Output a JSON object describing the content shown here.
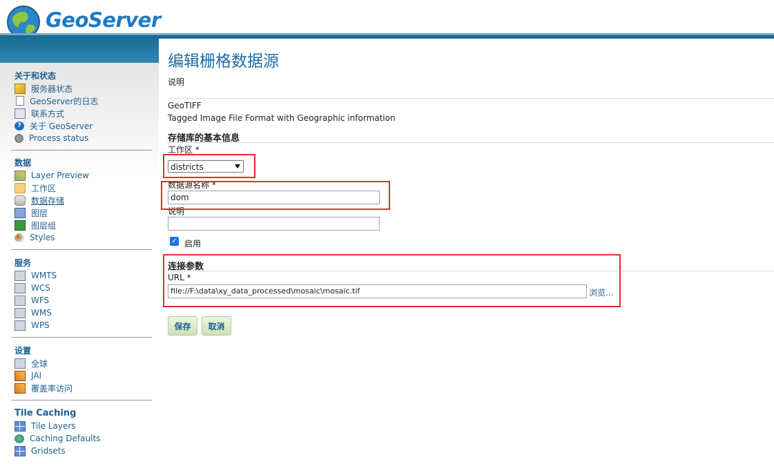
{
  "header": {
    "logo_text": "GeoServer"
  },
  "sidebar": {
    "sections": [
      {
        "title": "关于和状态",
        "items": [
          {
            "label": "服务器状态",
            "icon": "status-icon"
          },
          {
            "label": "GeoServer的日志",
            "icon": "log-icon"
          },
          {
            "label": "联系方式",
            "icon": "contact-icon"
          },
          {
            "label": "关于 GeoServer",
            "icon": "info-icon"
          },
          {
            "label": "Process status",
            "icon": "gear-icon"
          }
        ]
      },
      {
        "title": "数据",
        "items": [
          {
            "label": "Layer Preview",
            "icon": "map-icon"
          },
          {
            "label": "工作区",
            "icon": "folder-icon"
          },
          {
            "label": "数据存储",
            "icon": "database-icon"
          },
          {
            "label": "图层",
            "icon": "layer-icon"
          },
          {
            "label": "图层组",
            "icon": "layer-group-icon"
          },
          {
            "label": "Styles",
            "icon": "style-icon"
          }
        ]
      },
      {
        "title": "服务",
        "items": [
          {
            "label": "WMTS",
            "icon": "service-icon"
          },
          {
            "label": "WCS",
            "icon": "service-icon"
          },
          {
            "label": "WFS",
            "icon": "service-icon"
          },
          {
            "label": "WMS",
            "icon": "service-icon"
          },
          {
            "label": "WPS",
            "icon": "service-icon"
          }
        ]
      },
      {
        "title": "设置",
        "items": [
          {
            "label": "全球",
            "icon": "global-icon"
          },
          {
            "label": "JAI",
            "icon": "jai-icon"
          },
          {
            "label": "覆盖率访问",
            "icon": "coverage-icon"
          }
        ]
      },
      {
        "title": "Tile Caching",
        "items": [
          {
            "label": "Tile Layers",
            "icon": "grid-icon"
          },
          {
            "label": "Caching Defaults",
            "icon": "globe-icon"
          },
          {
            "label": "Gridsets",
            "icon": "grid-icon"
          }
        ]
      }
    ]
  },
  "main": {
    "title": "编辑栅格数据源",
    "subtitle": "说明",
    "format_name": "GeoTIFF",
    "format_desc": "Tagged Image File Format with Geographic information",
    "basic_section": "存储库的基本信息",
    "workspace_label": "工作区 *",
    "workspace_value": "districts",
    "name_label": "数据源名称 *",
    "name_value": "dom",
    "desc_label": "说明",
    "desc_value": "",
    "enabled_label": "启用",
    "enabled": true,
    "conn_section": "连接参数",
    "url_label": "URL *",
    "url_value": "file://F:\\data\\xy_data_processed\\mosaic\\mosaic.tif",
    "browse_label": "浏览...",
    "save_label": "保存",
    "cancel_label": "取消"
  }
}
